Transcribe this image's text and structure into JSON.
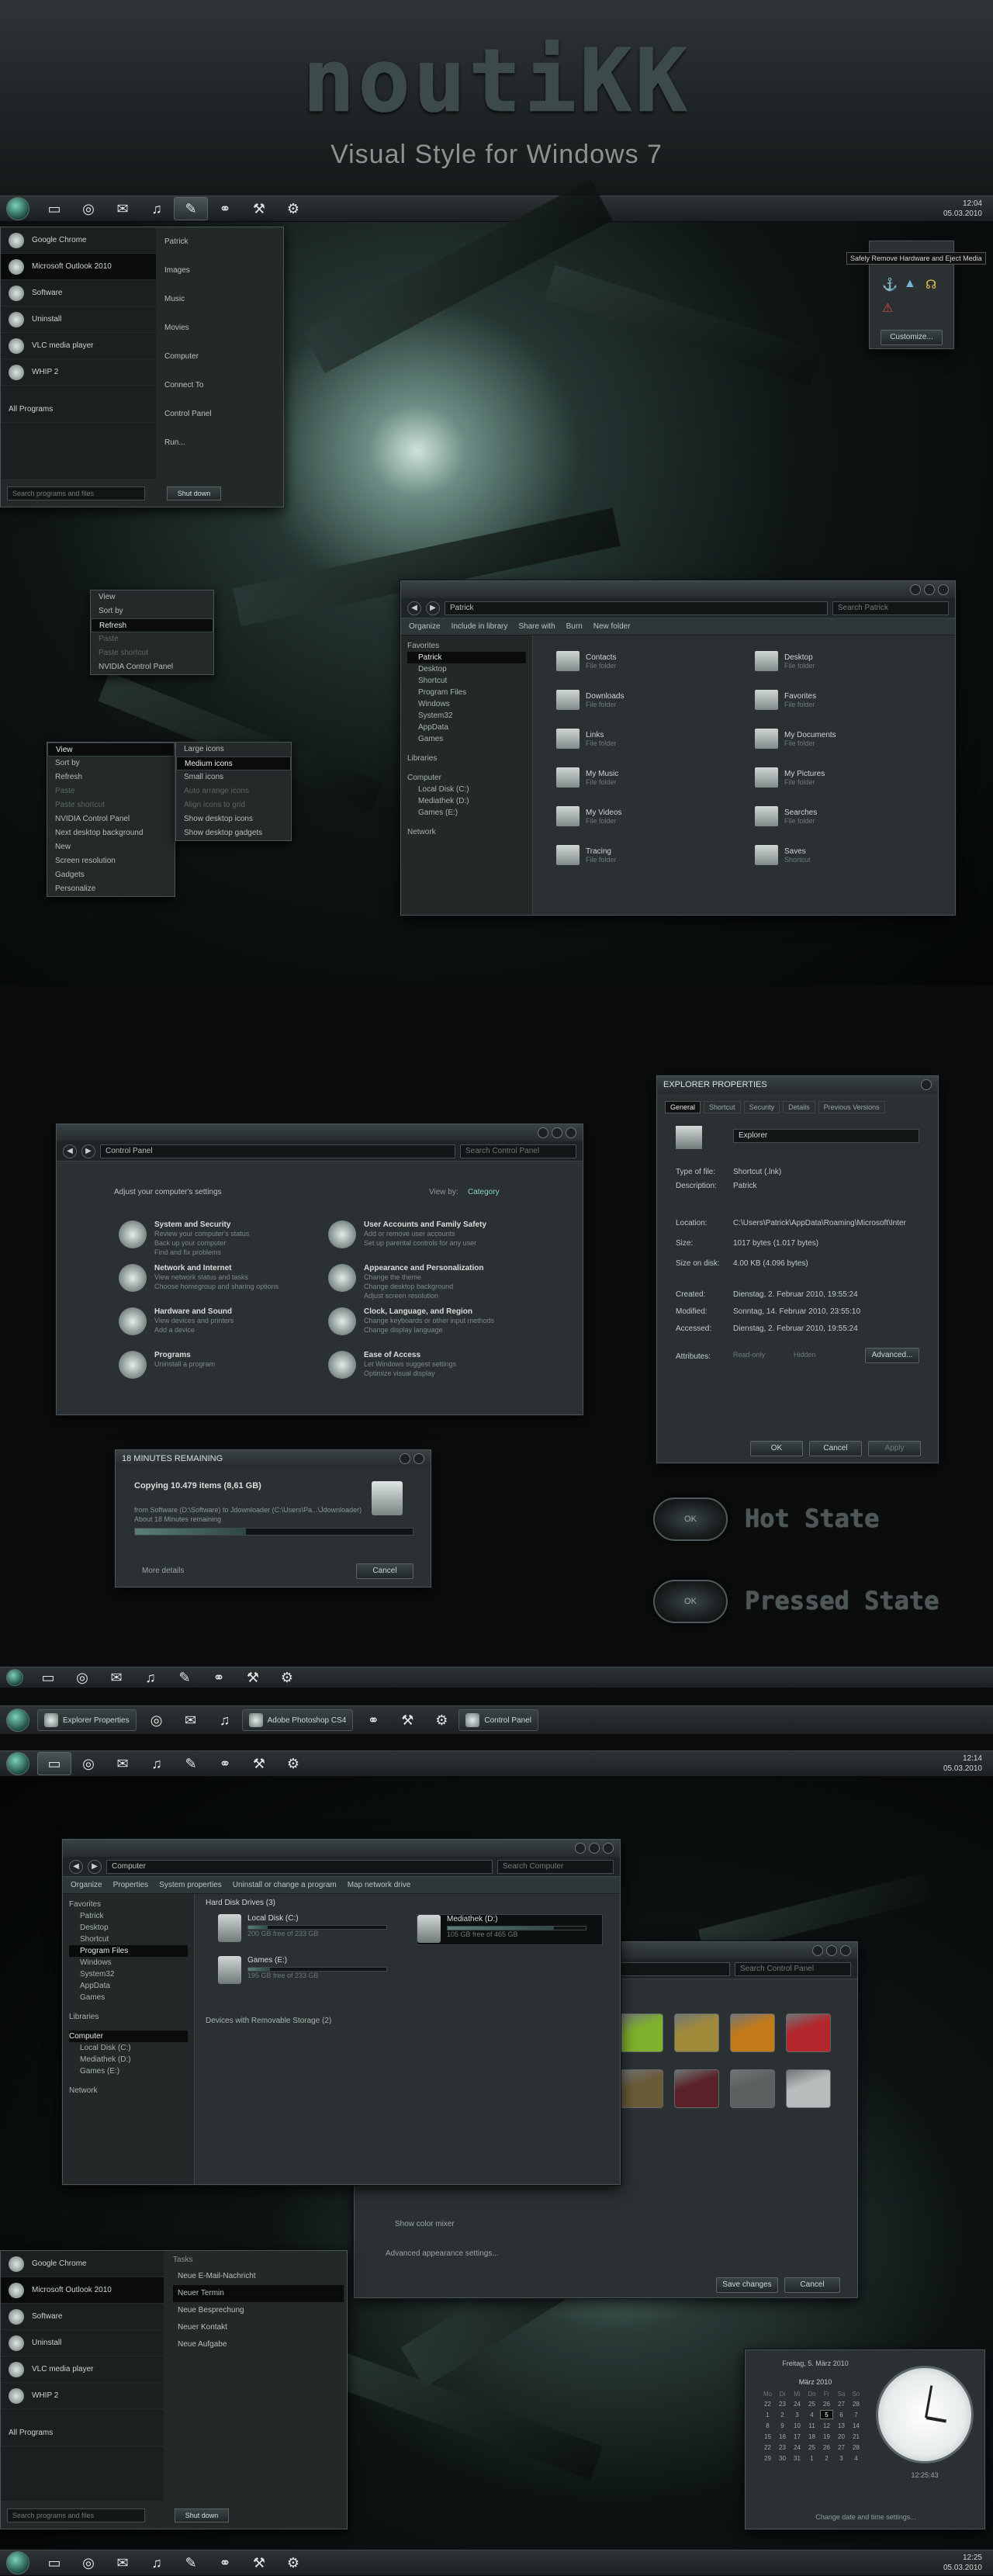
{
  "header": {
    "logo": "noutiKK",
    "subtitle": "Visual Style for Windows 7"
  },
  "taskbar": {
    "clock_time": "12:04",
    "clock_date": "05.03.2010",
    "clock2_time": "12:14",
    "clock3_time": "12:25",
    "icons": [
      "folder-icon",
      "chrome-icon",
      "mail-icon",
      "music-icon",
      "feather-icon",
      "network-icon",
      "wrench-icon",
      "gear-icon"
    ]
  },
  "tray_popup": {
    "tooltip": "Safely Remove Hardware and Eject Media",
    "customize": "Customize..."
  },
  "start_menu": {
    "pinned": [
      "Google Chrome",
      "Microsoft Outlook 2010",
      "Software",
      "Uninstall",
      "VLC media player",
      "WHIP 2"
    ],
    "all_programs": "All Programs",
    "right": [
      "Patrick",
      "Images",
      "Music",
      "Movies",
      "Computer",
      "Connect To",
      "Control Panel",
      "Run..."
    ],
    "search_placeholder": "Search programs and files",
    "shutdown": "Shut down"
  },
  "context_menu_small": [
    "View",
    "Sort by",
    "Refresh",
    "Paste",
    "Paste shortcut",
    "NVIDIA Control Panel"
  ],
  "context_menu_desktop": [
    "View",
    "Sort by",
    "Refresh",
    "Paste",
    "Paste shortcut",
    "NVIDIA Control Panel",
    "Next desktop background",
    "New",
    "Screen resolution",
    "Gadgets",
    "Personalize"
  ],
  "view_submenu": [
    "Large icons",
    "Medium icons",
    "Small icons",
    "Auto arrange icons",
    "Align icons to grid",
    "Show desktop icons",
    "Show desktop gadgets"
  ],
  "explorer1": {
    "address": "Patrick",
    "search": "Search Patrick",
    "commands": [
      "Organize",
      "Include in library",
      "Share with",
      "Burn",
      "New folder"
    ],
    "nav": [
      "Favorites",
      "Patrick",
      "Desktop",
      "Shortcut",
      "Program Files",
      "Windows",
      "System32",
      "AppData",
      "Games",
      "Libraries",
      "Computer",
      "Local Disk (C:)",
      "Mediathek (D:)",
      "Games (E:)",
      "Network"
    ],
    "items": [
      {
        "name": "Contacts",
        "type": "File folder"
      },
      {
        "name": "Desktop",
        "type": "File folder"
      },
      {
        "name": "Downloads",
        "type": "File folder"
      },
      {
        "name": "Favorites",
        "type": "File folder"
      },
      {
        "name": "Links",
        "type": "File folder"
      },
      {
        "name": "My Documents",
        "type": "File folder"
      },
      {
        "name": "My Music",
        "type": "File folder"
      },
      {
        "name": "My Pictures",
        "type": "File folder"
      },
      {
        "name": "My Videos",
        "type": "File folder"
      },
      {
        "name": "Searches",
        "type": "File folder"
      },
      {
        "name": "Tracing",
        "type": "File folder"
      },
      {
        "name": "Saves",
        "type": "Shortcut"
      }
    ]
  },
  "control_panel": {
    "address": "Control Panel",
    "search": "Search Control Panel",
    "heading": "Adjust your computer's settings",
    "view_by": "View by:",
    "category": "Category",
    "categories": [
      {
        "title": "System and Security",
        "lines": [
          "Review your computer's status",
          "Back up your computer",
          "Find and fix problems"
        ]
      },
      {
        "title": "User Accounts and Family Safety",
        "lines": [
          "Add or remove user accounts",
          "Set up parental controls for any user"
        ]
      },
      {
        "title": "Network and Internet",
        "lines": [
          "View network status and tasks",
          "Choose homegroup and sharing options"
        ]
      },
      {
        "title": "Appearance and Personalization",
        "lines": [
          "Change the theme",
          "Change desktop background",
          "Adjust screen resolution"
        ]
      },
      {
        "title": "Hardware and Sound",
        "lines": [
          "View devices and printers",
          "Add a device"
        ]
      },
      {
        "title": "Clock, Language, and Region",
        "lines": [
          "Change keyboards or other input methods",
          "Change display language"
        ]
      },
      {
        "title": "Programs",
        "lines": [
          "Uninstall a program"
        ]
      },
      {
        "title": "Ease of Access",
        "lines": [
          "Let Windows suggest settings",
          "Optimize visual display"
        ]
      }
    ]
  },
  "properties": {
    "title": "EXPLORER PROPERTIES",
    "tabs": [
      "General",
      "Shortcut",
      "Security",
      "Details",
      "Previous Versions"
    ],
    "name": "Explorer",
    "rows": [
      {
        "k": "Type of file:",
        "v": "Shortcut (.lnk)"
      },
      {
        "k": "Description:",
        "v": "Patrick"
      },
      {
        "k": "Location:",
        "v": "C:\\Users\\Patrick\\AppData\\Roaming\\Microsoft\\Inter"
      },
      {
        "k": "Size:",
        "v": "1017 bytes (1.017 bytes)"
      },
      {
        "k": "Size on disk:",
        "v": "4.00 KB (4.096 bytes)"
      },
      {
        "k": "Created:",
        "v": "Dienstag, 2. Februar 2010, 19:55:24"
      },
      {
        "k": "Modified:",
        "v": "Sonntag, 14. Februar 2010, 23:55:10"
      },
      {
        "k": "Accessed:",
        "v": "Dienstag, 2. Februar 2010, 19:55:24"
      }
    ],
    "attributes": "Attributes:",
    "readonly": "Read-only",
    "hidden": "Hidden",
    "advanced": "Advanced...",
    "ok": "OK",
    "cancel": "Cancel",
    "apply": "Apply"
  },
  "copy_dialog": {
    "title": "18 MINUTES REMAINING",
    "heading": "Copying 10.479 items (8,61 GB)",
    "from_line": "from Software (D:\\Software) to Jdownloader (C:\\Users\\Pa...\\Jdownloader)",
    "remaining": "About 18 Minutes remaining",
    "more": "More details",
    "cancel": "Cancel",
    "progress": 0.4
  },
  "states": {
    "hot": "Hot State",
    "pressed": "Pressed State",
    "ok": "OK"
  },
  "taskbar_buttons": [
    "Explorer Properties",
    "Adobe Photoshop CS4",
    "Control Panel"
  ],
  "computer": {
    "address": "Computer",
    "search": "Search Computer",
    "commands": [
      "Organize",
      "Properties",
      "System properties",
      "Uninstall or change a program",
      "Map network drive"
    ],
    "nav": [
      "Favorites",
      "Patrick",
      "Desktop",
      "Shortcut",
      "Program Files",
      "Windows",
      "System32",
      "AppData",
      "Games",
      "Libraries",
      "Computer",
      "Local Disk (C:)",
      "Mediathek (D:)",
      "Games (E:)",
      "Network"
    ],
    "group1": "Hard Disk Drives (3)",
    "group2": "Devices with Removable Storage (2)",
    "drives": [
      {
        "name": "Local Disk (C:)",
        "free": "200 GB free of 233 GB",
        "used": 0.14
      },
      {
        "name": "Mediathek (D:)",
        "free": "105 GB free of 465 GB",
        "used": 0.77
      },
      {
        "name": "Games (E:)",
        "free": "195 GB free of 233 GB",
        "used": 0.16
      }
    ]
  },
  "personalize": {
    "search": "Search Control Panel",
    "show_mixer": "Show color mixer",
    "advanced": "Advanced appearance settings...",
    "save": "Save changes",
    "cancel": "Cancel",
    "swatches": [
      "#7fb02e",
      "#a08a3a",
      "#c27a18",
      "#b3262b",
      "#6b5a3a",
      "#5a2228",
      "#5a5f60",
      "#b9bcbc"
    ]
  },
  "start_menu2": {
    "tasks_title": "Tasks",
    "tasks": [
      "Neue E-Mail-Nachricht",
      "Neuer Termin",
      "Neue Besprechung",
      "Neuer Kontakt",
      "Neue Aufgabe"
    ]
  },
  "calendar": {
    "date_line": "Freitag, 5. März 2010",
    "month": "März 2010",
    "days": [
      "Mo",
      "Di",
      "Mi",
      "Do",
      "Fr",
      "Sa",
      "So"
    ],
    "weeks": [
      [
        "22",
        "23",
        "24",
        "25",
        "26",
        "27",
        "28"
      ],
      [
        "1",
        "2",
        "3",
        "4",
        "5",
        "6",
        "7"
      ],
      [
        "8",
        "9",
        "10",
        "11",
        "12",
        "13",
        "14"
      ],
      [
        "15",
        "16",
        "17",
        "18",
        "19",
        "20",
        "21"
      ],
      [
        "22",
        "23",
        "24",
        "25",
        "26",
        "27",
        "28"
      ],
      [
        "29",
        "30",
        "31",
        "1",
        "2",
        "3",
        "4"
      ]
    ],
    "time": "12:25:43",
    "change": "Change date and time settings..."
  }
}
